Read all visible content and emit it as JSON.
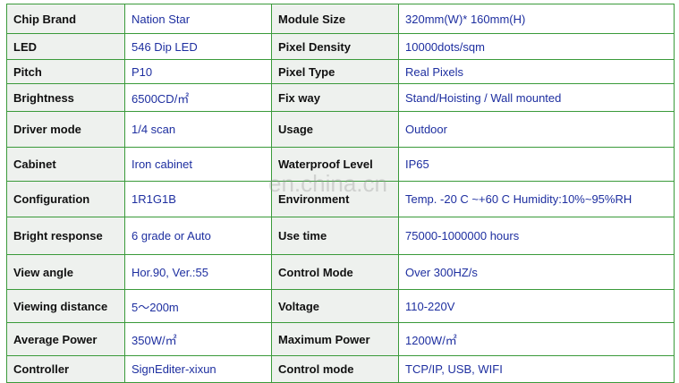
{
  "specs": [
    {
      "k1": "Chip Brand",
      "v1": "Nation Star",
      "k2": "Module Size",
      "v2": "320mm(W)* 160mm(H)"
    },
    {
      "k1": "LED",
      "v1": "546 Dip LED",
      "k2": "Pixel Density",
      "v2": "10000dots/sqm"
    },
    {
      "k1": "Pitch",
      "v1": "P10",
      "k2": "Pixel Type",
      "v2": "Real Pixels"
    },
    {
      "k1": "Brightness",
      "v1": "6500CD/㎡",
      "k2": "Fix way",
      "v2": "Stand/Hoisting / Wall  mounted"
    },
    {
      "k1": "Driver mode",
      "v1": "1/4 scan",
      "k2": "Usage",
      "v2": "Outdoor"
    },
    {
      "k1": "Cabinet",
      "v1": "Iron cabinet",
      "k2": "Waterproof Level",
      "v2": "IP65"
    },
    {
      "k1": "Configuration",
      "v1": "1R1G1B",
      "k2": "Environment",
      "v2": "Temp. -20 C ~+60 C Humidity:10%~95%RH"
    },
    {
      "k1": "Bright response",
      "v1": "6 grade or Auto",
      "k2": "Use time",
      "v2": "75000-1000000 hours"
    },
    {
      "k1": "View angle",
      "v1": "Hor.90, Ver.:55",
      "k2": "Control Mode",
      "v2": "Over 300HZ/s"
    },
    {
      "k1": "Viewing distance",
      "v1": "5～200m",
      "k2": "Voltage",
      "v2": "110-220V"
    },
    {
      "k1": "Average Power",
      "v1": "350W/㎡",
      "k2": "Maximum Power",
      "v2": "1200W/㎡"
    },
    {
      "k1": "Controller",
      "v1": "SignEditer-xixun",
      "k2": "Control mode",
      "v2": "TCP/IP, USB,  WIFI"
    }
  ],
  "watermark": "en.china.cn"
}
